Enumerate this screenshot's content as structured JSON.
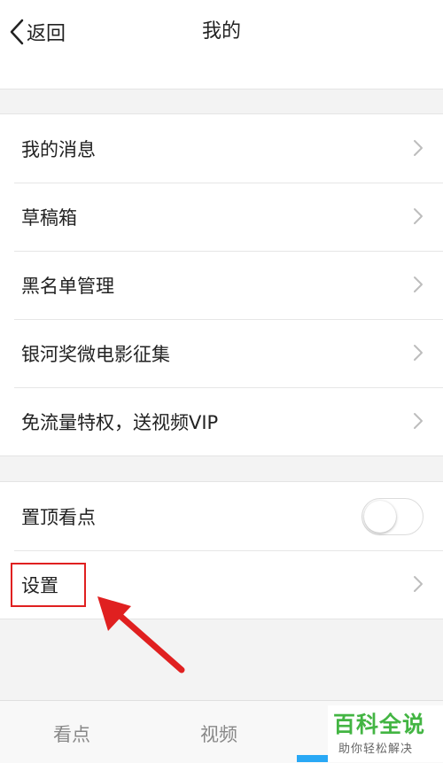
{
  "header": {
    "back_label": "返回",
    "title": "我的"
  },
  "group1": {
    "items": [
      {
        "label": "我的消息"
      },
      {
        "label": "草稿箱"
      },
      {
        "label": "黑名单管理"
      },
      {
        "label": "银河奖微电影征集"
      },
      {
        "label": "免流量特权，送视频VIP"
      }
    ]
  },
  "group2": {
    "pin_label": "置顶看点",
    "pin_enabled": false,
    "settings_label": "设置"
  },
  "tabbar": {
    "tabs": [
      {
        "label": "看点"
      },
      {
        "label": "视频"
      }
    ]
  },
  "watermark": {
    "title": "百科全说",
    "subtitle": "助你轻松解决"
  },
  "colors": {
    "annotation_red": "#e02020",
    "active_tab_blue": "#29a8f5",
    "watermark_green": "#43b543"
  }
}
